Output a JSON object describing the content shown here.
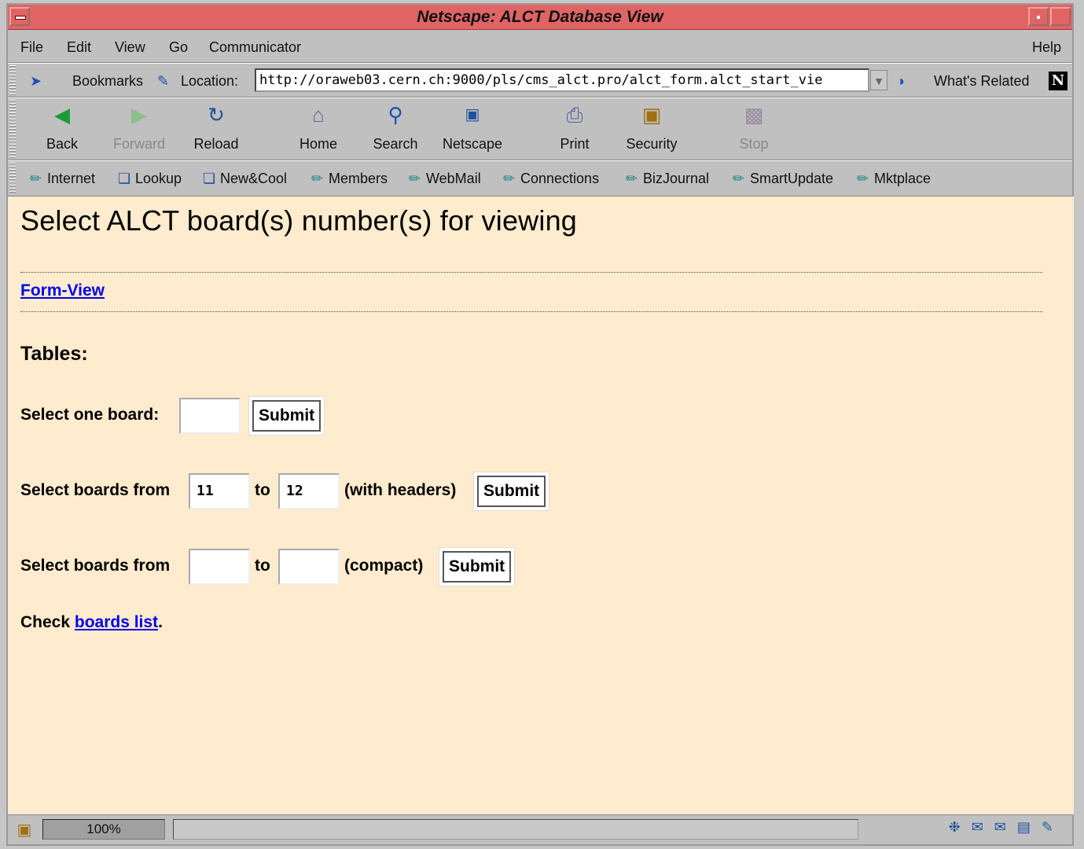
{
  "window": {
    "title": "Netscape: ALCT Database View"
  },
  "menu": {
    "file": "File",
    "edit": "Edit",
    "view": "View",
    "go": "Go",
    "communicator": "Communicator",
    "help": "Help"
  },
  "location_bar": {
    "bookmarks": "Bookmarks",
    "location_label": "Location:",
    "url": "http://oraweb03.cern.ch:9000/pls/cms_alct.pro/alct_form.alct_start_vie",
    "whats_related": "What's Related"
  },
  "nav": {
    "back": "Back",
    "forward": "Forward",
    "reload": "Reload",
    "home": "Home",
    "search": "Search",
    "netscape": "Netscape",
    "print": "Print",
    "security": "Security",
    "stop": "Stop"
  },
  "personal_bar": [
    "Internet",
    "Lookup",
    "New&Cool",
    "Members",
    "WebMail",
    "Connections",
    "BizJournal",
    "SmartUpdate",
    "Mktplace"
  ],
  "page": {
    "heading": "Select ALCT board(s) number(s) for viewing",
    "form_view_link": "Form-View",
    "tables_heading": "Tables:",
    "row1": {
      "label": "Select one board:",
      "value": "",
      "submit": "Submit"
    },
    "row2": {
      "label": "Select boards from",
      "from": "11",
      "to_label": "to",
      "to": "12",
      "suffix": "(with headers)",
      "submit": "Submit"
    },
    "row3": {
      "label": "Select boards from",
      "from": "",
      "to_label": "to",
      "to": "",
      "suffix": "(compact)",
      "submit": "Submit"
    },
    "check_prefix": "Check",
    "boards_list_link": "boards list",
    "check_suffix": "."
  },
  "status": {
    "progress": "100%"
  },
  "colors": {
    "title_bar": "#e06464",
    "content_bg": "#ffebcd",
    "link": "#0000ee"
  }
}
